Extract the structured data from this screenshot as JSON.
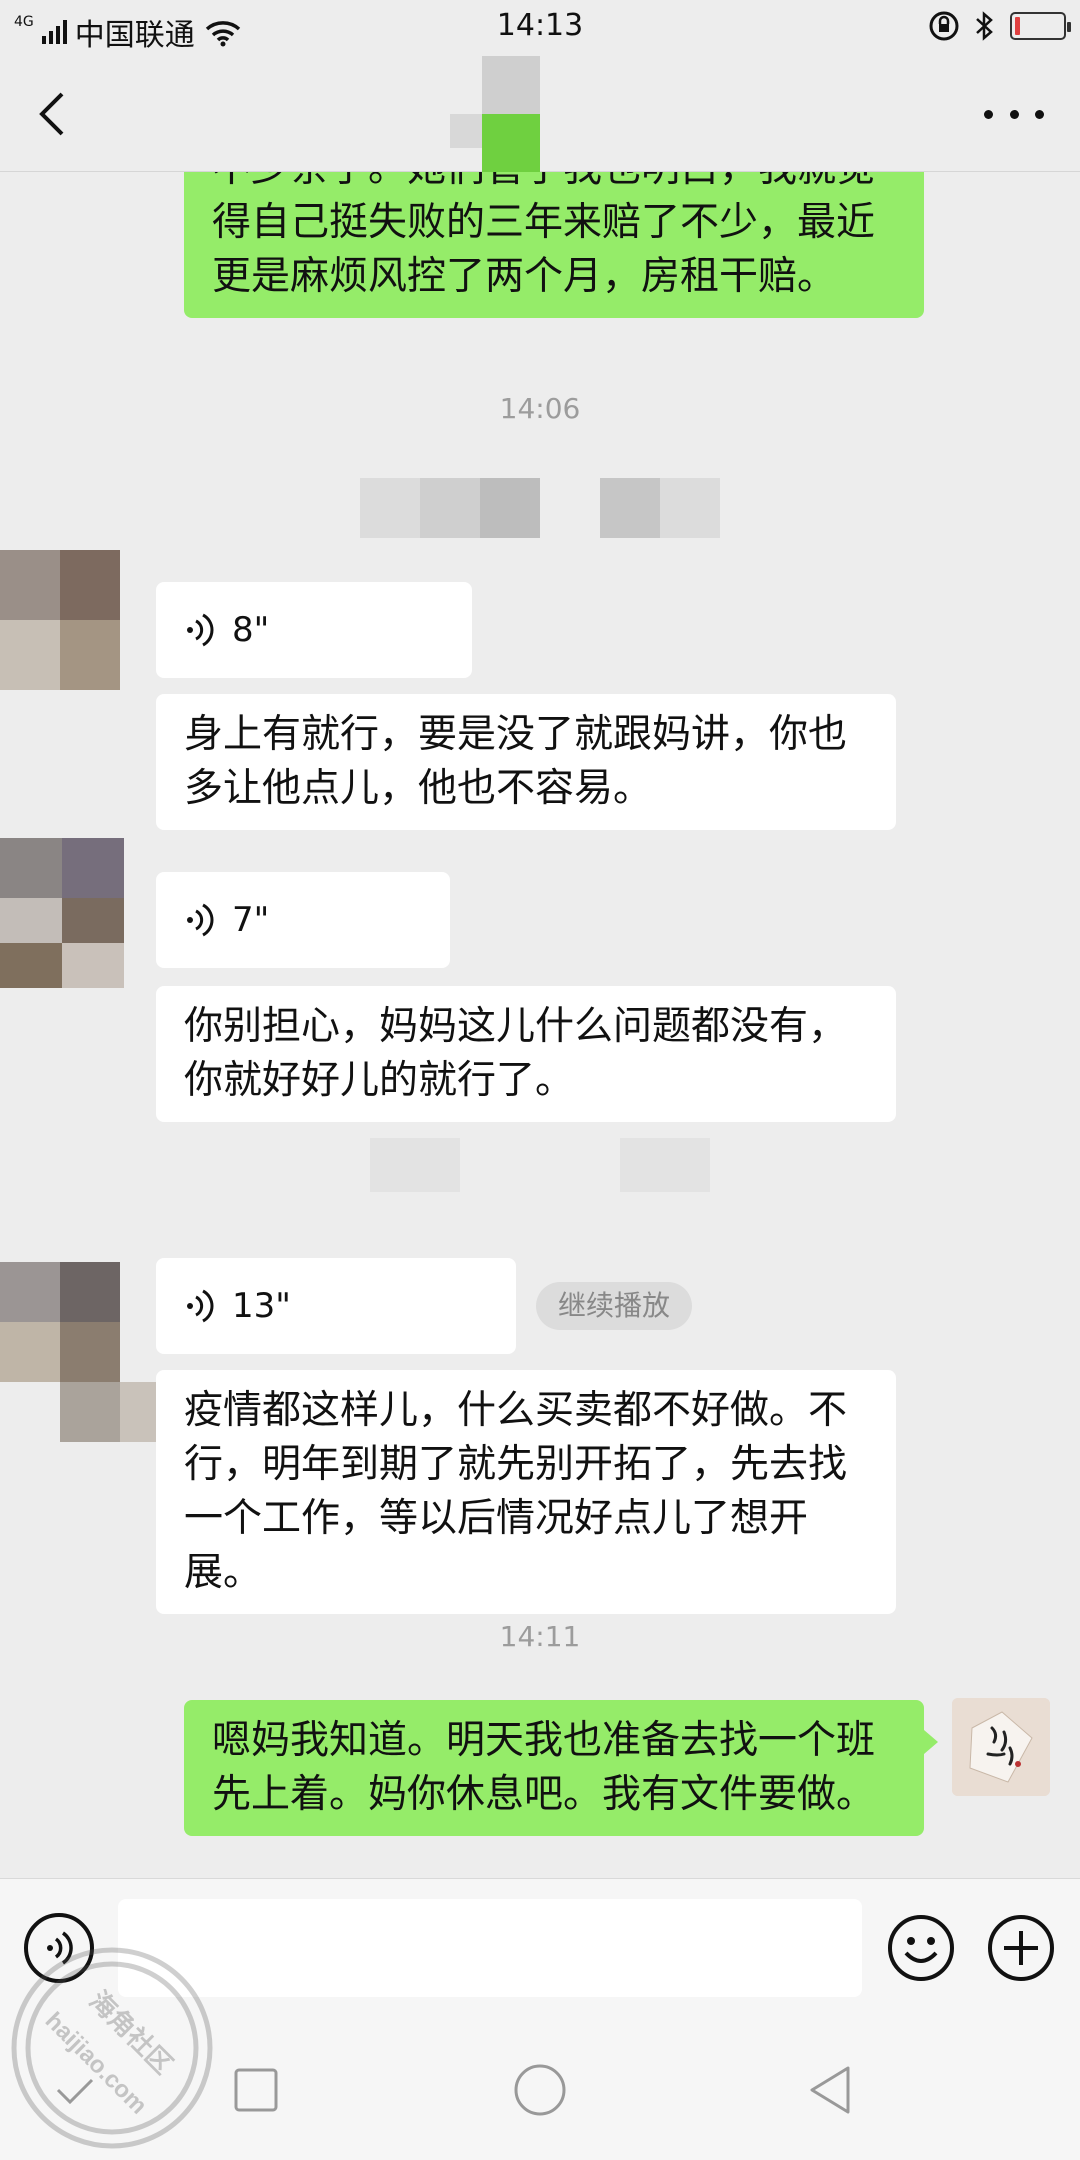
{
  "status_bar": {
    "network": "4G",
    "carrier": "中国联通",
    "time": "14:13"
  },
  "nav": {
    "back_icon": "chevron-left-icon",
    "more_icon": "more-horizontal-icon"
  },
  "messages": {
    "m1": {
      "direction": "out",
      "lines": [
        "不少亲了。她们管了我也明白，我就觉",
        "得自己挺失败的三年来赔了不少，最近",
        "更是麻烦风控了两个月，房租干赔。"
      ]
    },
    "ts1": "14:06",
    "v1": {
      "direction": "in",
      "duration": "8\""
    },
    "m2": {
      "direction": "in",
      "lines": [
        "身上有就行，要是没了就跟妈讲，你也",
        "多让他点儿，他也不容易。"
      ]
    },
    "v2": {
      "direction": "in",
      "duration": "7\""
    },
    "m3": {
      "direction": "in",
      "lines": [
        "你别担心，妈妈这儿什么问题都没有，",
        "你就好好儿的就行了。"
      ]
    },
    "v3": {
      "direction": "in",
      "duration": "13\"",
      "action": "继续播放"
    },
    "m4": {
      "direction": "in",
      "lines": [
        "疫情都这样儿，什么买卖都不好做。不",
        "行，明年到期了就先别开拓了，先去找",
        "一个工作，等以后情况好点儿了想开展。"
      ]
    },
    "ts2": "14:11",
    "m5": {
      "direction": "out",
      "lines": [
        "嗯妈我知道。明天我也准备去找一个班",
        "先上着。妈你休息吧。我有文件要做。"
      ]
    }
  },
  "input_bar": {
    "voice_icon": "voice-input-icon",
    "emoji_icon": "emoji-icon",
    "plus_icon": "plus-icon",
    "text_value": ""
  },
  "system_nav": {
    "icons": [
      "square-icon",
      "home-circle-icon",
      "back-triangle-icon"
    ]
  },
  "watermark": {
    "text1": "海角社区",
    "text2": "haijiao.com"
  },
  "colors": {
    "background": "#ededed",
    "outgoing_bubble": "#95ec69",
    "incoming_bubble": "#ffffff",
    "timestamp": "#9c9c9c"
  }
}
